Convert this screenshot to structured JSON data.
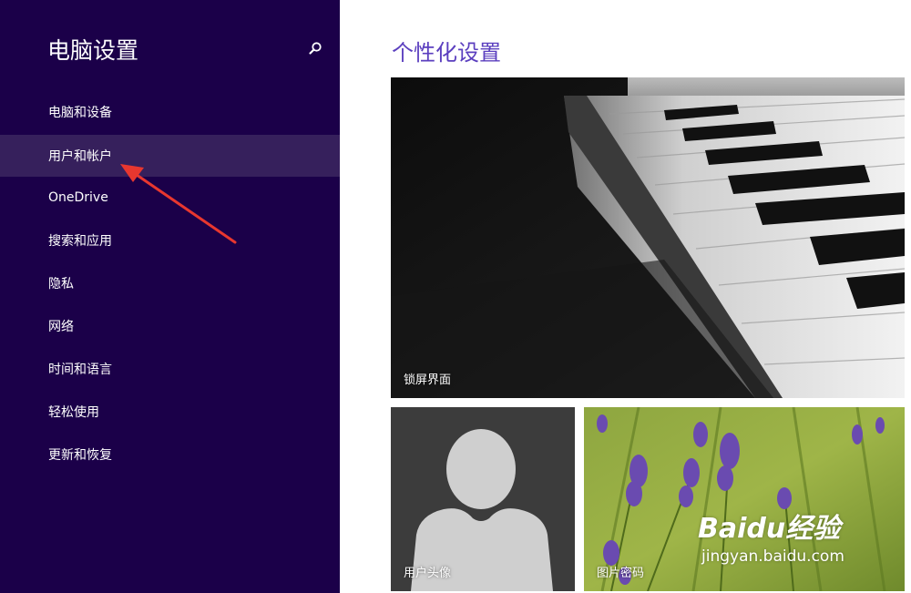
{
  "sidebar": {
    "title": "电脑设置",
    "search_icon": "search-icon",
    "selected_index": 1,
    "items": [
      {
        "label": "电脑和设备"
      },
      {
        "label": "用户和帐户"
      },
      {
        "label": "OneDrive"
      },
      {
        "label": "搜索和应用"
      },
      {
        "label": "隐私"
      },
      {
        "label": "网络"
      },
      {
        "label": "时间和语言"
      },
      {
        "label": "轻松使用"
      },
      {
        "label": "更新和恢复"
      }
    ]
  },
  "main": {
    "title": "个性化设置",
    "tiles": {
      "lock_screen": {
        "label": "锁屏界面"
      },
      "account_picture": {
        "label": "用户头像"
      },
      "picture_password": {
        "label": "图片密码"
      }
    }
  },
  "watermark": {
    "logo_text": "Baidu经验",
    "url": "jingyan.baidu.com"
  },
  "colors": {
    "sidebar_bg": "#1b0049",
    "sidebar_selected": "#36205c",
    "title_accent": "#5b3fbf",
    "annotation_arrow": "#e8372f"
  }
}
